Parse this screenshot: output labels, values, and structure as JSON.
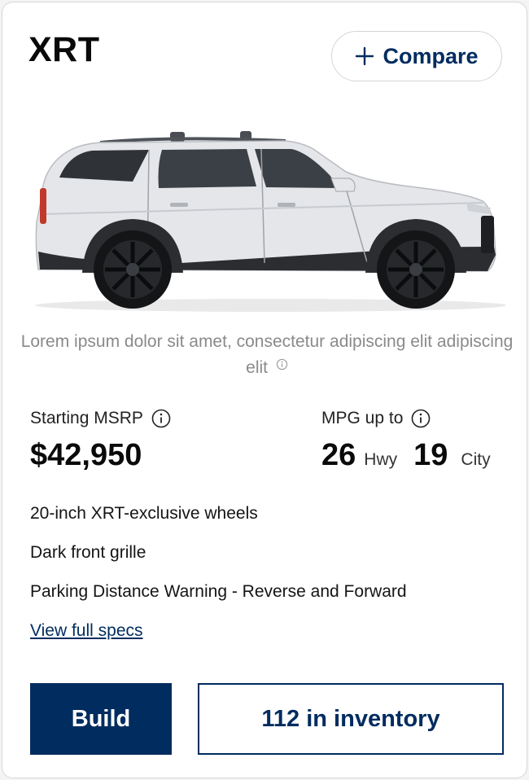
{
  "card": {
    "trim_name": "XRT",
    "compare_label": "Compare",
    "tagline": "Lorem ipsum dolor sit amet, consectetur adipiscing elit adipiscing elit",
    "msrp": {
      "label": "Starting MSRP",
      "value": "$42,950"
    },
    "mpg": {
      "label": "MPG up to",
      "highway_value": "26",
      "highway_unit": "Hwy",
      "city_value": "19",
      "city_unit": "City"
    },
    "features": [
      "20-inch XRT-exclusive wheels",
      "Dark front grille",
      "Parking Distance Warning - Reverse and Forward"
    ],
    "specs_link": "View full specs",
    "build_label": "Build",
    "inventory_label": "112 in inventory",
    "icons": {
      "compare": "plus-icon",
      "info": "info-circle-icon",
      "vehicle": "suv-side-view-image"
    },
    "colors": {
      "brand_navy": "#002c5f",
      "vehicle_body": "#e4e6e9"
    }
  }
}
